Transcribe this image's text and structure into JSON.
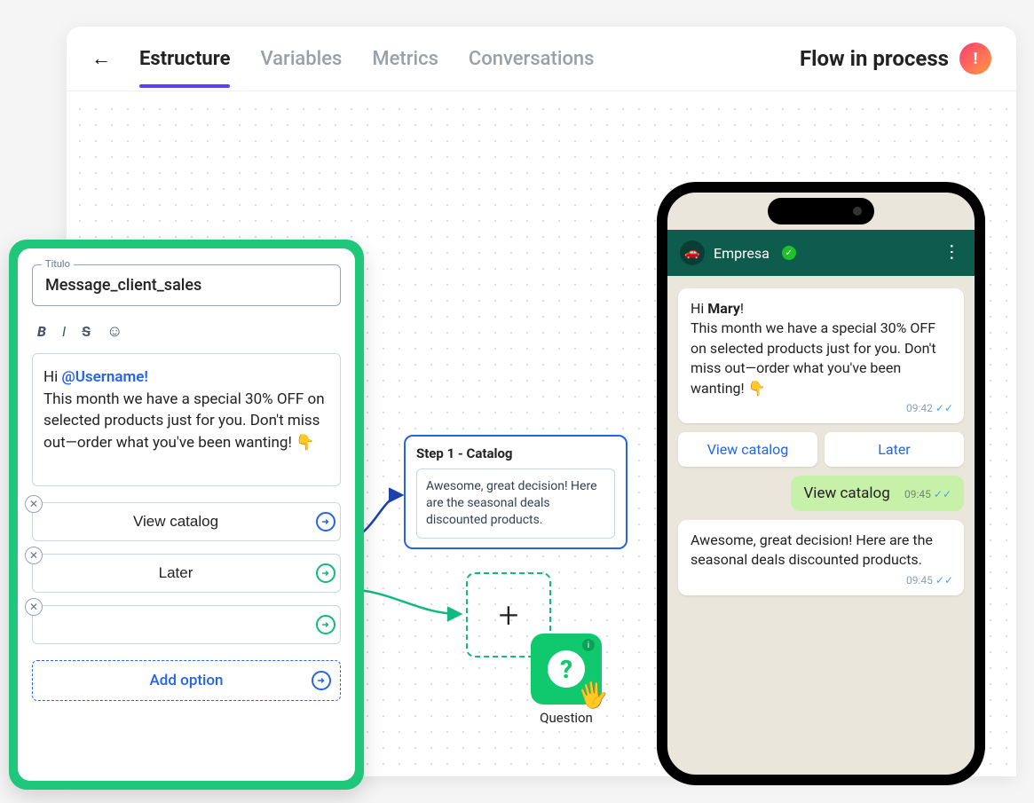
{
  "header": {
    "tabs": [
      "Estructure",
      "Variables",
      "Metrics",
      "Conversations"
    ],
    "active_tab": 0,
    "flow_status": "Flow in process",
    "status_icon": "!"
  },
  "editor": {
    "title_label": "Titulo",
    "title_value": "Message_client_sales",
    "toolbar": [
      "B",
      "I",
      "S",
      "☺"
    ],
    "message_prefix": "Hi ",
    "username_token": "@Username!",
    "message_body": "This month we have a special 30% OFF on selected products just for you. Don't miss out—order what you've been wanting! 👇",
    "options": [
      "View catalog",
      "Later",
      ""
    ],
    "add_option_label": "Add option"
  },
  "step": {
    "title": "Step 1 - Catalog",
    "body": "Awesome, great decision! Here are the seasonal deals discounted products."
  },
  "question_block": {
    "label": "Question"
  },
  "phone": {
    "company": "Empresa",
    "msg1_prefix": "Hi ",
    "msg1_name": "Mary",
    "msg1_suffix": "!",
    "msg1_body": "This month we have a special 30% OFF on selected products just for you. Don't miss out—order what you've been wanting! 👇",
    "msg1_time": "09:42",
    "btn_view": "View catalog",
    "btn_later": "Later",
    "out_text": "View catalog",
    "out_time": "09:45",
    "msg2_body": "Awesome, great decision! Here are the seasonal deals discounted products.",
    "msg2_time": "09:45"
  }
}
